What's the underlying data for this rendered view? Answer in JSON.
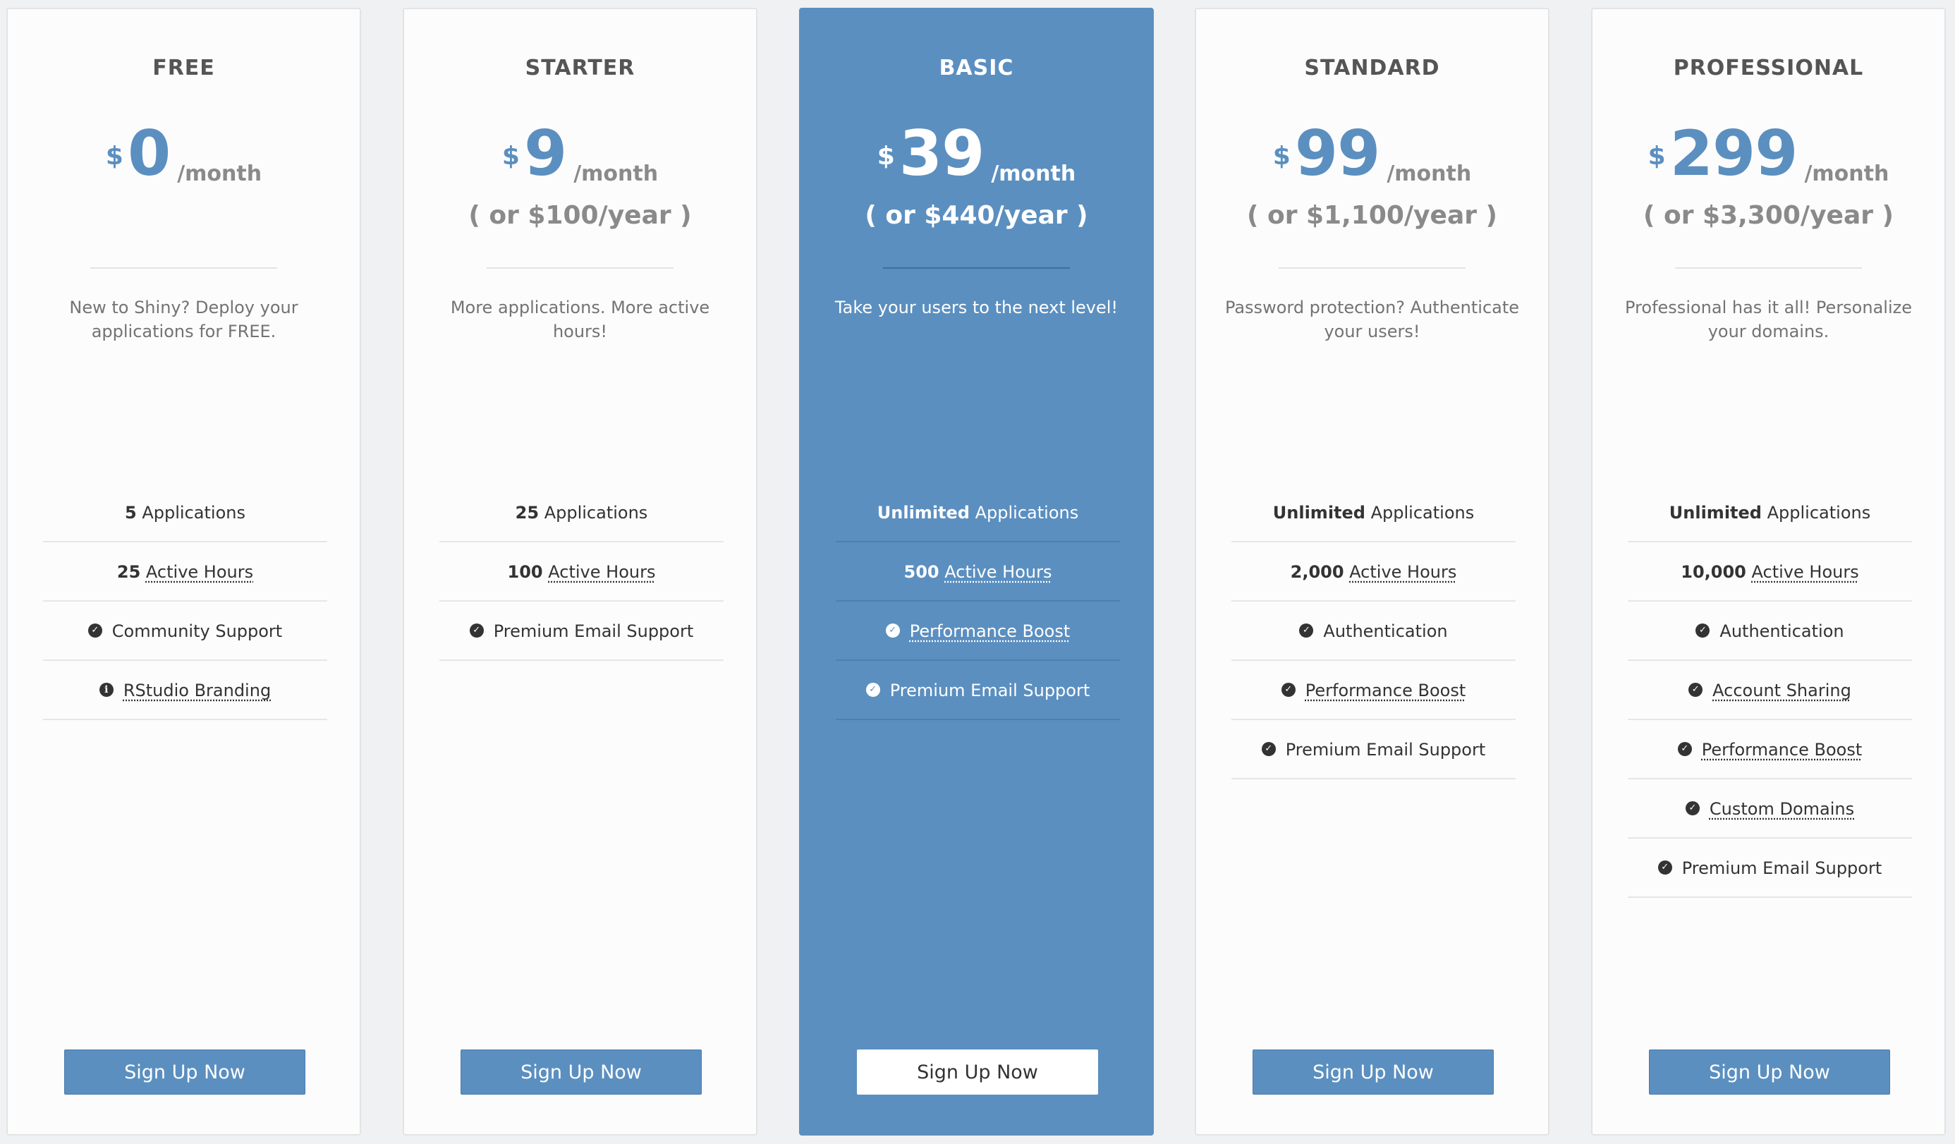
{
  "plans": [
    {
      "name": "FREE",
      "currency": "$",
      "price": "0",
      "period": "/month",
      "yearly": "",
      "description": "New to Shiny? Deploy your applications for FREE.",
      "features": [
        {
          "bold": "5",
          "text": " Applications",
          "icon": "",
          "dotted": false
        },
        {
          "bold": "25",
          "text": "Active Hours",
          "icon": "",
          "dotted": true
        },
        {
          "bold": "",
          "text": "Community Support",
          "icon": "check-circle",
          "dotted": false
        },
        {
          "bold": "",
          "text": "RStudio Branding",
          "icon": "info-circle",
          "dotted": true
        }
      ],
      "button": "Sign Up Now"
    },
    {
      "name": "STARTER",
      "currency": "$",
      "price": "9",
      "period": "/month",
      "yearly": "( or $100/year )",
      "description": "More applications. More active hours!",
      "features": [
        {
          "bold": "25",
          "text": " Applications",
          "icon": "",
          "dotted": false
        },
        {
          "bold": "100",
          "text": "Active Hours",
          "icon": "",
          "dotted": true
        },
        {
          "bold": "",
          "text": "Premium Email Support",
          "icon": "check-circle",
          "dotted": false
        }
      ],
      "button": "Sign Up Now"
    },
    {
      "name": "BASIC",
      "currency": "$",
      "price": "39",
      "period": "/month",
      "yearly": "( or $440/year )",
      "description": "Take your users to the next level!",
      "features": [
        {
          "bold": "Unlimited",
          "text": " Applications",
          "icon": "",
          "dotted": false
        },
        {
          "bold": "500",
          "text": "Active Hours",
          "icon": "",
          "dotted": true
        },
        {
          "bold": "",
          "text": "Performance Boost",
          "icon": "check-circle",
          "dotted": true
        },
        {
          "bold": "",
          "text": "Premium Email Support",
          "icon": "check-circle",
          "dotted": false
        }
      ],
      "button": "Sign Up Now"
    },
    {
      "name": "STANDARD",
      "currency": "$",
      "price": "99",
      "period": "/month",
      "yearly": "( or $1,100/year )",
      "description": "Password protection? Authenticate your users!",
      "features": [
        {
          "bold": "Unlimited",
          "text": " Applications",
          "icon": "",
          "dotted": false
        },
        {
          "bold": "2,000",
          "text": "Active Hours",
          "icon": "",
          "dotted": true
        },
        {
          "bold": "",
          "text": "Authentication",
          "icon": "check-circle",
          "dotted": false
        },
        {
          "bold": "",
          "text": "Performance Boost",
          "icon": "check-circle",
          "dotted": true
        },
        {
          "bold": "",
          "text": "Premium Email Support",
          "icon": "check-circle",
          "dotted": false
        }
      ],
      "button": "Sign Up Now"
    },
    {
      "name": "PROFESSIONAL",
      "currency": "$",
      "price": "299",
      "period": "/month",
      "yearly": "( or $3,300/year )",
      "description": "Professional has it all! Personalize your domains.",
      "features": [
        {
          "bold": "Unlimited",
          "text": " Applications",
          "icon": "",
          "dotted": false
        },
        {
          "bold": "10,000",
          "text": "Active Hours",
          "icon": "",
          "dotted": true
        },
        {
          "bold": "",
          "text": "Authentication",
          "icon": "check-circle",
          "dotted": false
        },
        {
          "bold": "",
          "text": "Account Sharing",
          "icon": "check-circle",
          "dotted": true
        },
        {
          "bold": "",
          "text": "Performance Boost",
          "icon": "check-circle",
          "dotted": true
        },
        {
          "bold": "",
          "text": "Custom Domains",
          "icon": "check-circle",
          "dotted": true
        },
        {
          "bold": "",
          "text": "Premium Email Support",
          "icon": "check-circle",
          "dotted": false
        }
      ],
      "button": "Sign Up Now"
    }
  ],
  "colors": {
    "accent": "#5b8fc0",
    "card_background": "#fcfcfc",
    "page_background": "#f0f1f3",
    "text_dark": "#333333",
    "text_muted": "#737373"
  }
}
